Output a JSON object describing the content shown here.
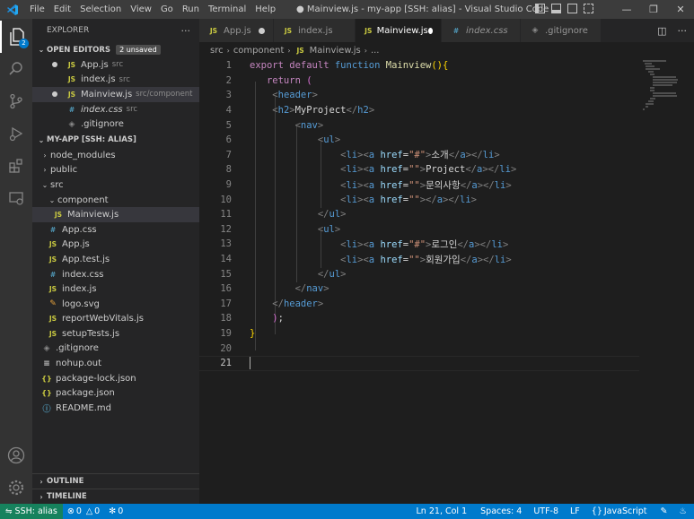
{
  "titlebar": {
    "menu": [
      "File",
      "Edit",
      "Selection",
      "View",
      "Go",
      "Run",
      "Terminal",
      "Help"
    ],
    "window_title": "● Mainview.js - my-app [SSH: alias] - Visual Studio Code"
  },
  "activity_bar": {
    "explorer_badge": "2"
  },
  "sidebar": {
    "title": "EXPLORER",
    "more": "···",
    "open_editors": {
      "label": "OPEN EDITORS",
      "badge": "2 unsaved",
      "items": [
        {
          "name": "App.js",
          "desc": "src"
        },
        {
          "name": "index.js",
          "desc": "src"
        },
        {
          "name": "Mainview.js",
          "desc": "src/component"
        },
        {
          "name": "index.css",
          "desc": "src"
        },
        {
          "name": ".gitignore",
          "desc": ""
        }
      ]
    },
    "project": {
      "label": "MY-APP [SSH: ALIAS]",
      "items": [
        {
          "name": "node_modules"
        },
        {
          "name": "public"
        },
        {
          "name": "src"
        },
        {
          "name": "component"
        },
        {
          "name": "Mainview.js"
        },
        {
          "name": "App.css"
        },
        {
          "name": "App.js"
        },
        {
          "name": "App.test.js"
        },
        {
          "name": "index.css"
        },
        {
          "name": "index.js"
        },
        {
          "name": "logo.svg"
        },
        {
          "name": "reportWebVitals.js"
        },
        {
          "name": "setupTests.js"
        },
        {
          "name": ".gitignore"
        },
        {
          "name": "nohup.out"
        },
        {
          "name": "package-lock.json"
        },
        {
          "name": "package.json"
        },
        {
          "name": "README.md"
        }
      ]
    },
    "outline": "OUTLINE",
    "timeline": "TIMELINE"
  },
  "tabs": [
    {
      "label": "App.js"
    },
    {
      "label": "index.js"
    },
    {
      "label": "Mainview.js"
    },
    {
      "label": "index.css"
    },
    {
      "label": ".gitignore"
    }
  ],
  "breadcrumb": [
    "src",
    "component",
    "Mainview.js",
    "..."
  ],
  "editor": {
    "line_numbers": [
      "1",
      "2",
      "3",
      "4",
      "5",
      "6",
      "7",
      "8",
      "9",
      "10",
      "11",
      "12",
      "13",
      "14",
      "15",
      "16",
      "17",
      "18",
      "19",
      "20",
      "21"
    ],
    "code": {
      "l1_export": "export",
      "l1_default": "default",
      "l1_function": "function",
      "l1_name": "Mainview",
      "l1_parens": "()",
      "l1_brace": "{",
      "l2_return": "return",
      "l2_paren": "(",
      "header": "header",
      "h2": "h2",
      "project_title": "MyProject",
      "nav": "nav",
      "ul": "ul",
      "li": "li",
      "a": "a",
      "href": "href",
      "hash": "\"#\"",
      "empty": "\"\"",
      "menu_1": "소개",
      "menu_2": "Project",
      "menu_3": "문의사항",
      "login": "로그인",
      "signup": "회원가입",
      "l18_close": ")",
      "l18_semi": ";",
      "l19_brace": "}"
    }
  },
  "statusbar": {
    "remote": "SSH: alias",
    "errors": "0",
    "warnings": "0",
    "ports": "0",
    "position": "Ln 21, Col 1",
    "spaces": "Spaces: 4",
    "encoding": "UTF-8",
    "eol": "LF",
    "language": "JavaScript"
  }
}
